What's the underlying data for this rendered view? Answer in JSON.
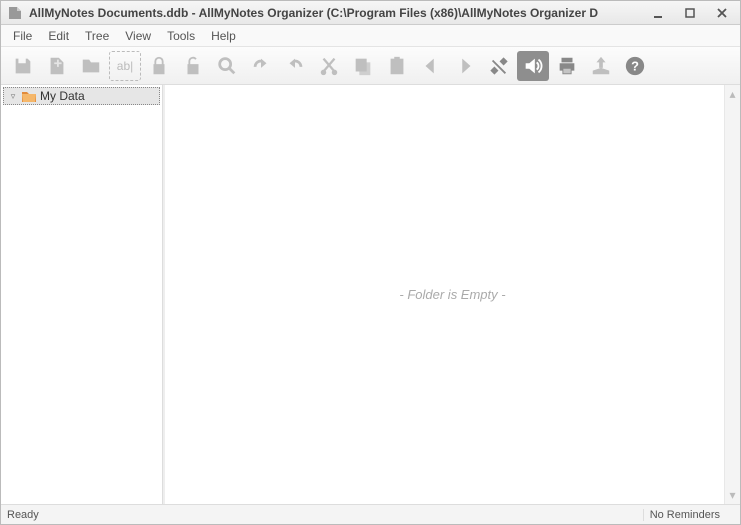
{
  "window": {
    "title": "AllMyNotes Documents.ddb - AllMyNotes Organizer (C:\\Program Files (x86)\\AllMyNotes Organizer D"
  },
  "menu": {
    "items": [
      "File",
      "Edit",
      "Tree",
      "View",
      "Tools",
      "Help"
    ]
  },
  "toolbar": {
    "buttons": [
      {
        "name": "save",
        "icon": "save-icon",
        "enabled": false
      },
      {
        "name": "new-note",
        "icon": "new-note-icon",
        "enabled": false
      },
      {
        "name": "new-folder",
        "icon": "new-folder-icon",
        "enabled": false
      },
      {
        "name": "rename",
        "icon": "rename-icon",
        "enabled": false
      },
      {
        "name": "lock",
        "icon": "lock-icon",
        "enabled": false
      },
      {
        "name": "unlock",
        "icon": "unlock-icon",
        "enabled": false
      },
      {
        "name": "find",
        "icon": "find-icon",
        "enabled": false
      },
      {
        "name": "undo",
        "icon": "undo-icon",
        "enabled": false
      },
      {
        "name": "redo",
        "icon": "redo-icon",
        "enabled": false
      },
      {
        "name": "cut",
        "icon": "cut-icon",
        "enabled": false
      },
      {
        "name": "copy",
        "icon": "copy-icon",
        "enabled": false
      },
      {
        "name": "paste",
        "icon": "paste-icon",
        "enabled": false
      },
      {
        "name": "back",
        "icon": "back-icon",
        "enabled": false
      },
      {
        "name": "forward",
        "icon": "forward-icon",
        "enabled": false
      },
      {
        "name": "settings",
        "icon": "settings-icon",
        "enabled": true
      },
      {
        "name": "sound",
        "icon": "sound-icon",
        "enabled": true,
        "active": true
      },
      {
        "name": "print",
        "icon": "print-icon",
        "enabled": true
      },
      {
        "name": "export",
        "icon": "export-icon",
        "enabled": false
      },
      {
        "name": "help",
        "icon": "help-icon",
        "enabled": true
      }
    ]
  },
  "tree": {
    "root": {
      "label": "My Data",
      "expanded": true
    }
  },
  "content": {
    "empty_message": "- Folder is Empty -"
  },
  "status": {
    "left": "Ready",
    "right": "No Reminders"
  }
}
